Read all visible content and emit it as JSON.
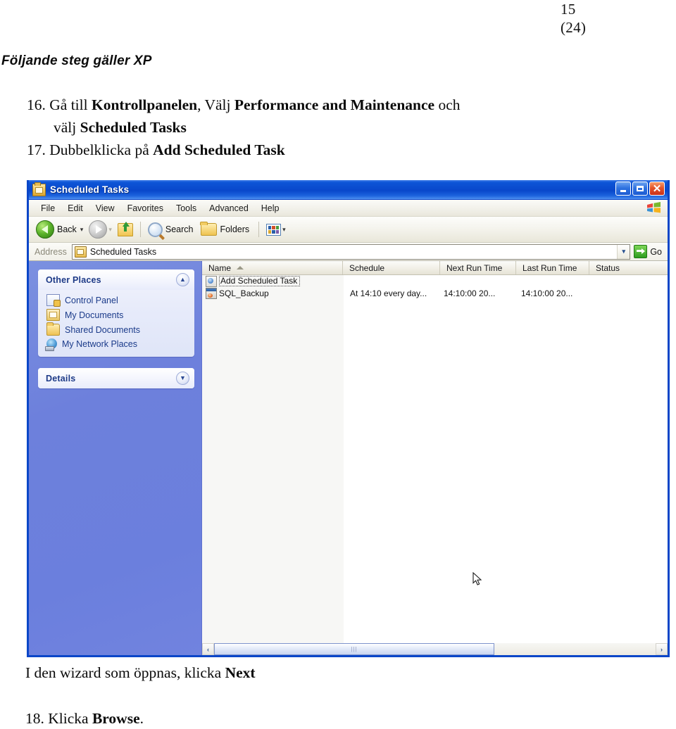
{
  "document": {
    "page_number": "15",
    "page_total": "(24)",
    "subtitle": "Följande steg gäller XP",
    "steps": [
      {
        "number": "16.",
        "line1_plain_a": "Gå till ",
        "line1_bold_a": "Kontrollpanelen",
        "line1_plain_b": ", Välj ",
        "line1_bold_b": "Performance and Maintenance",
        "line1_plain_c": " och",
        "line2_plain": "välj ",
        "line2_bold": "Scheduled Tasks"
      },
      {
        "number": "17.",
        "line1_plain_a": "Dubbelklicka på ",
        "line1_bold_a": "Add Scheduled Task"
      }
    ],
    "after_screenshot_text_plain": "I den wizard som öppnas, klicka ",
    "after_screenshot_text_bold": "Next",
    "last_step_number": "18.",
    "last_step_plain": "Klicka ",
    "last_step_bold": "Browse",
    "last_step_period": "."
  },
  "screenshot": {
    "window": {
      "title": "Scheduled Tasks",
      "title_icon": "scheduled-tasks-icon",
      "controls": {
        "minimize": "minimize-icon",
        "maximize": "maximize-icon",
        "close": "close-icon",
        "close_glyph": "✕"
      }
    },
    "menubar": {
      "items": [
        "File",
        "Edit",
        "View",
        "Favorites",
        "Tools",
        "Advanced",
        "Help"
      ],
      "brand_icon": "windows-flag-icon"
    },
    "toolbar": {
      "back_label": "Back",
      "back_icon": "back-arrow-icon",
      "back_caret": "▾",
      "forward_icon": "forward-arrow-icon",
      "forward_caret": "▾",
      "up_icon": "up-folder-icon",
      "search_label": "Search",
      "search_icon": "magnifier-icon",
      "folders_label": "Folders",
      "folders_icon": "folder-icon",
      "views_icon": "views-icon",
      "views_caret": "▾"
    },
    "address": {
      "label": "Address",
      "icon": "scheduled-tasks-icon",
      "value": "Scheduled Tasks",
      "dropdown_glyph": "▾",
      "go_label": "Go",
      "go_icon": "go-arrow-icon"
    },
    "sidebar": {
      "panels": [
        {
          "title": "Other Places",
          "collapse_glyph": "⌃⌃",
          "items": [
            {
              "label": "Control Panel",
              "icon": "control-panel-icon"
            },
            {
              "label": "My Documents",
              "icon": "my-documents-icon"
            },
            {
              "label": "Shared Documents",
              "icon": "shared-documents-icon"
            },
            {
              "label": "My Network Places",
              "icon": "my-network-places-icon"
            }
          ]
        },
        {
          "title": "Details",
          "expand_glyph": "⌄⌄",
          "items": []
        }
      ]
    },
    "list": {
      "columns": [
        "Name",
        "Schedule",
        "Next Run Time",
        "Last Run Time",
        "Status"
      ],
      "sort_column": "Name",
      "sort_direction": "ascending",
      "rows": [
        {
          "name": "Add Scheduled Task",
          "icon": "add-scheduled-task-icon",
          "schedule": "",
          "next_run_time": "",
          "last_run_time": "",
          "status": "",
          "focused": true
        },
        {
          "name": "SQL_Backup",
          "icon": "sql-backup-task-icon",
          "schedule": "At 14:10 every day...",
          "next_run_time": "14:10:00  20...",
          "last_run_time": "14:10:00  20...",
          "status": "",
          "focused": false
        }
      ]
    },
    "scrollbar": {
      "left_glyph": "‹",
      "right_glyph": "›",
      "grip": "|||"
    },
    "cursor": "mouse-pointer-icon"
  },
  "colors": {
    "titlebar_blue": "#0947cb",
    "sidebar_blue": "#6d80dc",
    "panel_title": "#1d3a87",
    "close_red": "#c8301a",
    "go_green": "#2e9c1f"
  }
}
